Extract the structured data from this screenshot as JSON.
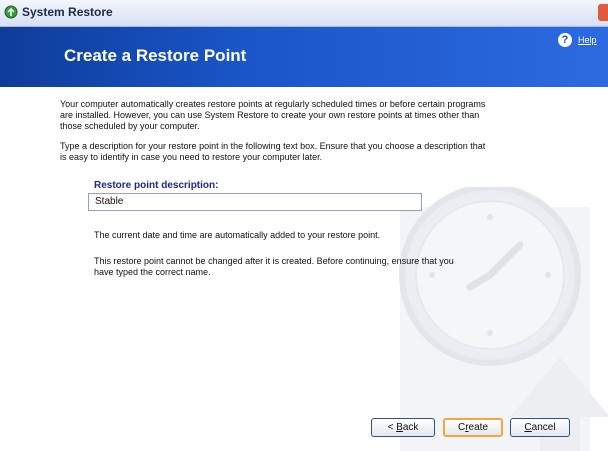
{
  "window": {
    "title": "System Restore",
    "icon": "system-restore-icon"
  },
  "header": {
    "title": "Create a Restore Point",
    "help_label": "Help",
    "help_icon": "help-icon",
    "background": "#1a56c8"
  },
  "content": {
    "intro": "Your computer automatically creates restore points at regularly scheduled times or before certain programs are installed. However, you can use System Restore to create your own restore points at times other than those scheduled by your computer.",
    "instruction": "Type a description for your restore point in the following text box. Ensure that you choose a description that is easy to identify in case you need to restore your computer later.",
    "description_label": "Restore point description:",
    "description_value": "Stable",
    "note_datetime": "The current date and time are automatically added to your restore point.",
    "note_permanent": "This restore point cannot be changed after it is created. Before continuing, ensure that you have typed the correct name."
  },
  "buttons": {
    "back": {
      "prefix": "< ",
      "accel": "B",
      "rest": "ack"
    },
    "create": {
      "prefix": "C",
      "accel": "r",
      "rest": "eate"
    },
    "cancel": {
      "prefix": "",
      "accel": "C",
      "rest": "ancel"
    }
  },
  "colors": {
    "accent": "#1a56c8",
    "label": "#1f2a88",
    "default_button_border": "#f0a93a"
  }
}
